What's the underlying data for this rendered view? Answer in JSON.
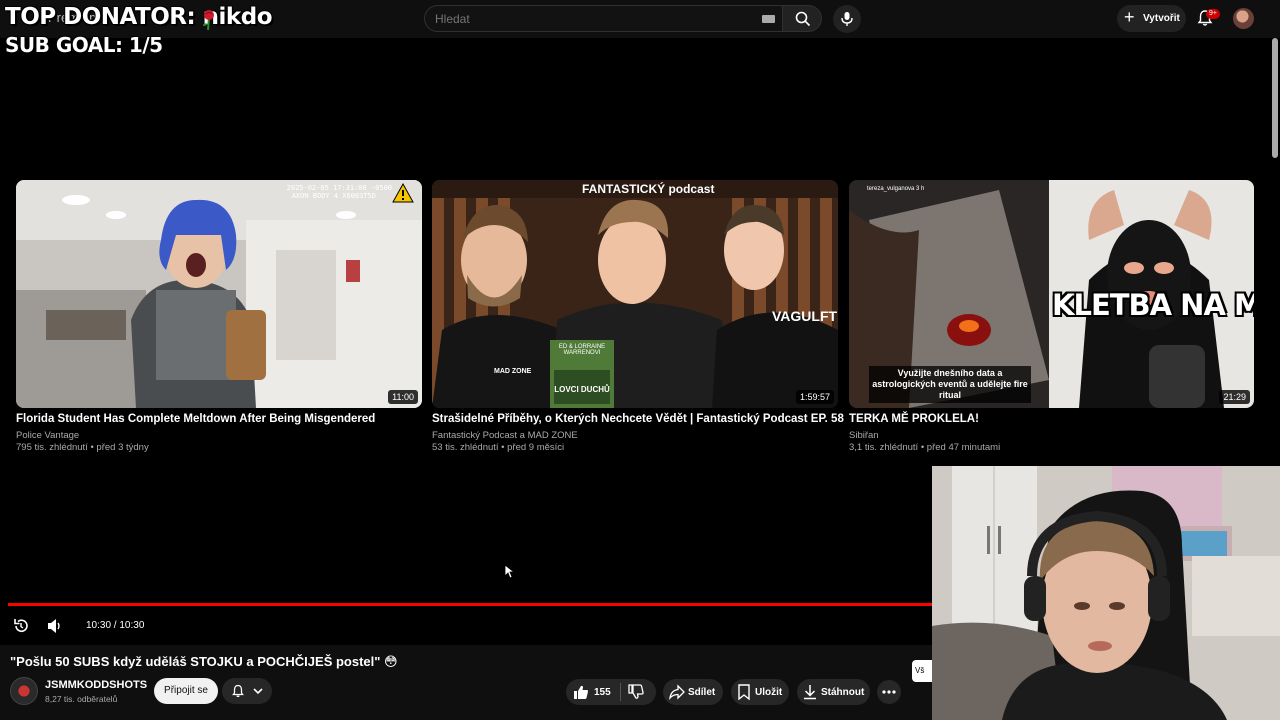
{
  "header": {
    "logo_text": "Premium",
    "search_placeholder": "Hledat",
    "create_label": "Vytvořit",
    "notification_badge": "9+"
  },
  "overlay": {
    "top_donator": "TOP DONATOR: nikdo",
    "sub_goal": "SUB GOAL: 1/5"
  },
  "videos": [
    {
      "title": "Florida Student Has Complete Meltdown After Being Misgendered",
      "channel": "Police Vantage",
      "meta": "795 tis. zhlédnutí • před 3 týdny",
      "duration": "11:00"
    },
    {
      "title": "Strašidelné Příběhy, o Kterých Nechcete Vědět | Fantastický Podcast EP. 58",
      "channel": "Fantastický Podcast a MAD ZONE",
      "meta": "53 tis. zhlédnutí • před 9 měsíci",
      "duration": "1:59:57"
    },
    {
      "title": "TERKA MĚ PROKLELA!",
      "channel": "Sibiřan",
      "meta": "3,1 tis. zhlédnutí • před 47 minutami",
      "duration": "21:29"
    }
  ],
  "thumb_text": {
    "t1_cam": "2025-02-05 17:31:08 -0500",
    "t1_cam2": "AXON BODY 4 X6003T5D",
    "t2_banner": "FANTASTICKÝ podcast",
    "t2_book_top": "ED & LORRAINE WARRENOVI",
    "t2_book_bottom": "LOVCI DUCHŮ",
    "t2_shirt_left": "MAD ZONE",
    "t2_shirt_right": "VAGULFT",
    "t3_big": "KLETBA NA MĚ!",
    "t3_caption": "Využijte dnešního data a astrologických eventů a udělejte fire ritual",
    "t3_story": "tereza_vulganova 3 h"
  },
  "player": {
    "progress": 1.0,
    "time": "10:30 / 10:30"
  },
  "current_video": {
    "title": "\"Pošlu 50 SUBS když uděláš STOJKU a POCHČIJEŠ postel\" 😳",
    "channel": "JSMMKODDSHOTS",
    "subscribers": "8,27 tis. odběratelů",
    "join_label": "Připojit se",
    "likes": "155",
    "share_label": "Sdílet",
    "save_label": "Uložit",
    "download_label": "Stáhnout"
  },
  "sidebar_peek_label": "Vš",
  "colors": {
    "accent": "#ff0000",
    "background": "#000000",
    "pill": "#272727"
  }
}
